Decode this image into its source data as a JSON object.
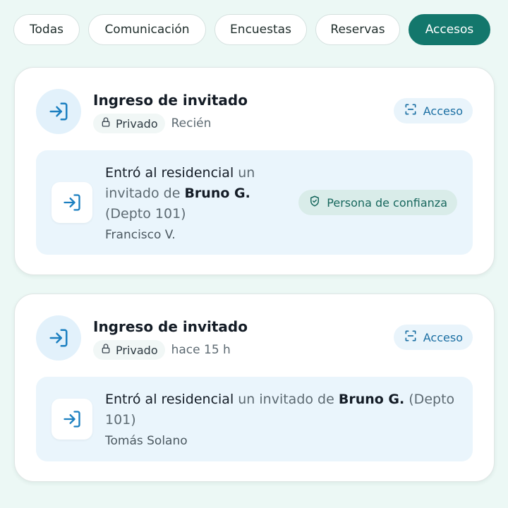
{
  "filters": [
    {
      "label": "Todas",
      "active": false
    },
    {
      "label": "Comunicación",
      "active": false
    },
    {
      "label": "Encuestas",
      "active": false
    },
    {
      "label": "Reservas",
      "active": false
    },
    {
      "label": "Accesos",
      "active": true
    }
  ],
  "cards": [
    {
      "icon": "login-icon",
      "title": "Ingreso de invitado",
      "privacy_label": "Privado",
      "time": "Recién",
      "category_label": "Acceso",
      "message": {
        "action": "Entró al residencial",
        "middle": " un invitado de ",
        "host": "Bruno G.",
        "unit": " (Depto 101)"
      },
      "actor": "Francisco V.",
      "badge": "Persona de confianza"
    },
    {
      "icon": "login-icon",
      "title": "Ingreso de invitado",
      "privacy_label": "Privado",
      "time": "hace 15 h",
      "category_label": "Acceso",
      "message": {
        "action": "Entró al residencial",
        "middle": " un invitado de ",
        "host": "Bruno G.",
        "unit": " (Depto 101)"
      },
      "actor": "Tomás Solano"
    }
  ],
  "colors": {
    "accent": "#13776c",
    "background": "#ecf8f5",
    "icon_blue": "#1b7fc0",
    "trust_badge_bg": "#d9ece9"
  }
}
